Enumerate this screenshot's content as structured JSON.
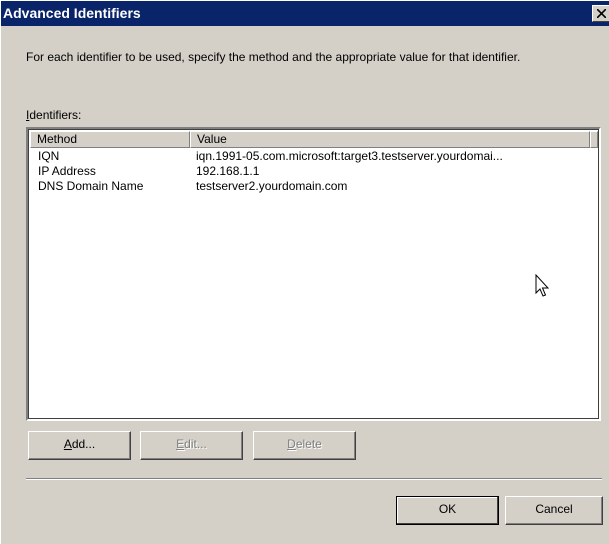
{
  "window": {
    "title": "Advanced Identifiers",
    "close_glyph": "✕"
  },
  "description": "For each identifier to be used, specify the method and the appropriate value for that identifier.",
  "identifiers_label": {
    "accel": "I",
    "rest": "dentifiers:"
  },
  "list": {
    "columns": [
      "Method",
      "Value"
    ],
    "rows": [
      {
        "method": "IQN",
        "value": "iqn.1991-05.com.microsoft:target3.testserver.yourdomai..."
      },
      {
        "method": "IP Address",
        "value": "192.168.1.1"
      },
      {
        "method": "DNS Domain Name",
        "value": "testserver2.yourdomain.com"
      }
    ]
  },
  "buttons": {
    "add": {
      "accel": "A",
      "rest": "dd..."
    },
    "edit": {
      "accel": "E",
      "rest": "dit..."
    },
    "delete": {
      "accel": "D",
      "rest": "elete"
    },
    "ok": "OK",
    "cancel": "Cancel"
  },
  "icons": {
    "close": "close-icon",
    "cursor": "mouse-pointer-icon"
  }
}
